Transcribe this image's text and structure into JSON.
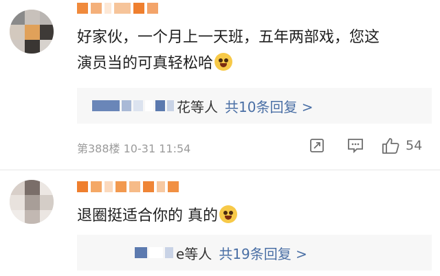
{
  "comments": [
    {
      "text_line1": "好家伙，一个月上一天班，五年两部戏，您这",
      "text_line2": "演员当的可真轻松哈",
      "emoji": "crying-laughing-emoji",
      "reply_summary": {
        "partial_name": "花等人",
        "link": "共10条回复 >"
      },
      "meta": "第388楼 10-31 11:54",
      "likes": "54"
    },
    {
      "text_line1": "退圈挺适合你的 真的",
      "emoji": "laughing-tears-emoji",
      "reply_summary": {
        "partial_name": "e等人",
        "link": "共19条回复 >"
      }
    }
  ],
  "colors": {
    "username_mosaic": "#f08a3c",
    "reply_link": "#4a6fa5",
    "reply_bg": "#f7f7f7",
    "meta": "#9a9a9a"
  },
  "icons": [
    "share-icon",
    "comment-icon",
    "like-icon"
  ]
}
